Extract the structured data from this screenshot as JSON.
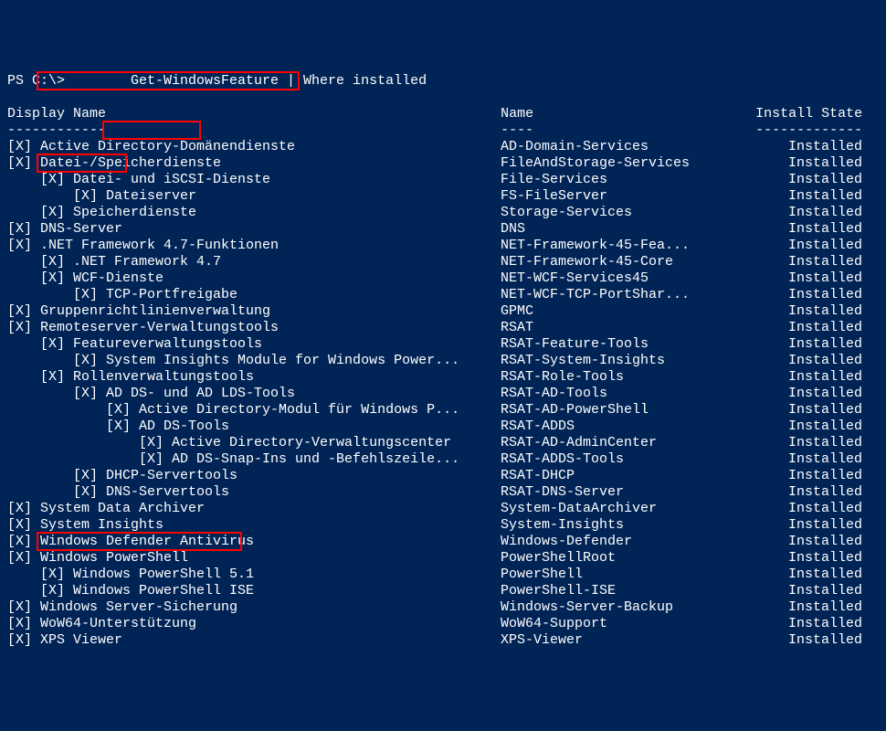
{
  "prompt": "PS C:\\>        Get-WindowsFeature | Where installed",
  "headers": {
    "display": "Display Name",
    "name": "Name",
    "state": "Install State"
  },
  "dashes": {
    "display": "------------",
    "name": "----",
    "state": "-------------"
  },
  "rows": [
    {
      "indent": 0,
      "display": "Active Directory-Domänendienste",
      "name": "AD-Domain-Services",
      "state": "Installed"
    },
    {
      "indent": 0,
      "display": "Datei-/Speicherdienste",
      "name": "FileAndStorage-Services",
      "state": "Installed"
    },
    {
      "indent": 1,
      "display": "Datei- und iSCSI-Dienste",
      "name": "File-Services",
      "state": "Installed"
    },
    {
      "indent": 2,
      "display": "Dateiserver",
      "name": "FS-FileServer",
      "state": "Installed"
    },
    {
      "indent": 1,
      "display": "Speicherdienste",
      "name": "Storage-Services",
      "state": "Installed"
    },
    {
      "indent": 0,
      "display": "DNS-Server",
      "name": "DNS",
      "state": "Installed"
    },
    {
      "indent": 0,
      "display": ".NET Framework 4.7-Funktionen",
      "name": "NET-Framework-45-Fea...",
      "state": "Installed"
    },
    {
      "indent": 1,
      "display": ".NET Framework 4.7",
      "name": "NET-Framework-45-Core",
      "state": "Installed"
    },
    {
      "indent": 1,
      "display": "WCF-Dienste",
      "name": "NET-WCF-Services45",
      "state": "Installed"
    },
    {
      "indent": 2,
      "display": "TCP-Portfreigabe",
      "name": "NET-WCF-TCP-PortShar...",
      "state": "Installed"
    },
    {
      "indent": 0,
      "display": "Gruppenrichtlinienverwaltung",
      "name": "GPMC",
      "state": "Installed"
    },
    {
      "indent": 0,
      "display": "Remoteserver-Verwaltungstools",
      "name": "RSAT",
      "state": "Installed"
    },
    {
      "indent": 1,
      "display": "Featureverwaltungstools",
      "name": "RSAT-Feature-Tools",
      "state": "Installed"
    },
    {
      "indent": 2,
      "display": "System Insights Module for Windows Power...",
      "name": "RSAT-System-Insights",
      "state": "Installed"
    },
    {
      "indent": 1,
      "display": "Rollenverwaltungstools",
      "name": "RSAT-Role-Tools",
      "state": "Installed"
    },
    {
      "indent": 2,
      "display": "AD DS- und AD LDS-Tools",
      "name": "RSAT-AD-Tools",
      "state": "Installed"
    },
    {
      "indent": 3,
      "display": "Active Directory-Modul für Windows P...",
      "name": "RSAT-AD-PowerShell",
      "state": "Installed"
    },
    {
      "indent": 3,
      "display": "AD DS-Tools",
      "name": "RSAT-ADDS",
      "state": "Installed"
    },
    {
      "indent": 4,
      "display": "Active Directory-Verwaltungscenter",
      "name": "RSAT-AD-AdminCenter",
      "state": "Installed"
    },
    {
      "indent": 4,
      "display": "AD DS-Snap-Ins und -Befehlszeile...",
      "name": "RSAT-ADDS-Tools",
      "state": "Installed"
    },
    {
      "indent": 2,
      "display": "DHCP-Servertools",
      "name": "RSAT-DHCP",
      "state": "Installed"
    },
    {
      "indent": 2,
      "display": "DNS-Servertools",
      "name": "RSAT-DNS-Server",
      "state": "Installed"
    },
    {
      "indent": 0,
      "display": "System Data Archiver",
      "name": "System-DataArchiver",
      "state": "Installed"
    },
    {
      "indent": 0,
      "display": "System Insights",
      "name": "System-Insights",
      "state": "Installed"
    },
    {
      "indent": 0,
      "display": "Windows Defender Antivirus",
      "name": "Windows-Defender",
      "state": "Installed"
    },
    {
      "indent": 0,
      "display": "Windows PowerShell",
      "name": "PowerShellRoot",
      "state": "Installed"
    },
    {
      "indent": 1,
      "display": "Windows PowerShell 5.1",
      "name": "PowerShell",
      "state": "Installed"
    },
    {
      "indent": 1,
      "display": "Windows PowerShell ISE",
      "name": "PowerShell-ISE",
      "state": "Installed"
    },
    {
      "indent": 0,
      "display": "Windows Server-Sicherung",
      "name": "Windows-Server-Backup",
      "state": "Installed"
    },
    {
      "indent": 0,
      "display": "WoW64-Unterstützung",
      "name": "WoW64-Support",
      "state": "Installed"
    },
    {
      "indent": 0,
      "display": "XPS Viewer",
      "name": "XPS-Viewer",
      "state": "Installed"
    }
  ],
  "highlights": [
    {
      "target_row": 0,
      "text": "Active Directory-Domänendienste"
    },
    {
      "target_row": 3,
      "text": "Dateiserver"
    },
    {
      "target_row": 5,
      "text": "DNS-Server"
    },
    {
      "target_row": 28,
      "text": "Windows Server-Sicherung"
    }
  ]
}
